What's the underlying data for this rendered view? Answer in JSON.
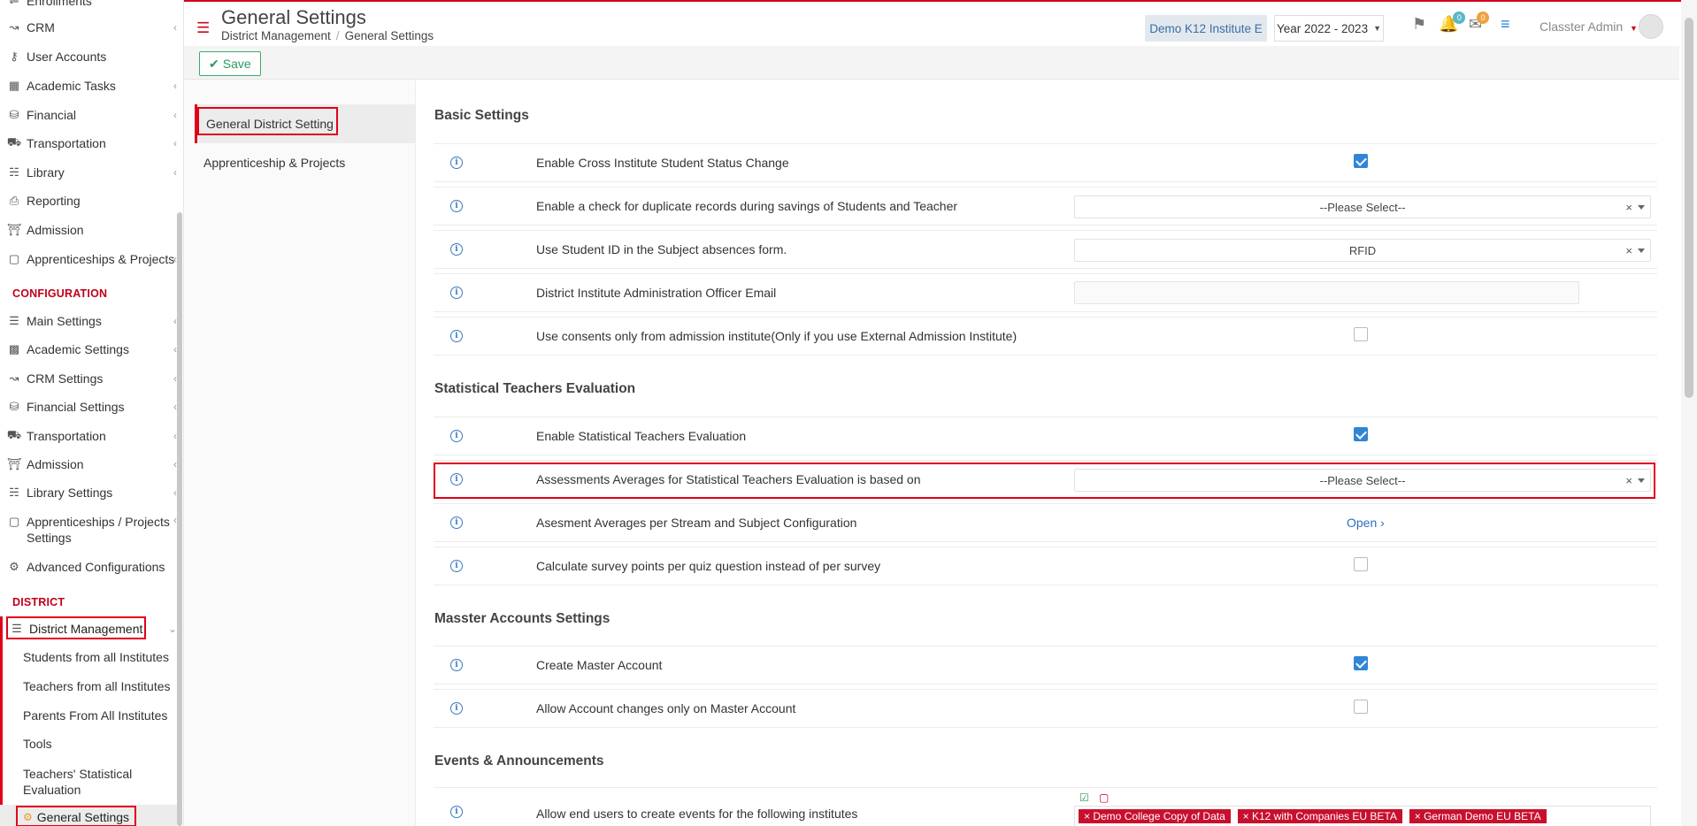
{
  "sidebar": {
    "items_top": [
      {
        "label": "Enrollments",
        "icon": "enrollments-icon"
      },
      {
        "label": "CRM",
        "icon": "crm-icon"
      },
      {
        "label": "User Accounts",
        "icon": "key-icon"
      },
      {
        "label": "Academic Tasks",
        "icon": "grid-icon"
      },
      {
        "label": "Financial",
        "icon": "coins-icon"
      },
      {
        "label": "Transportation",
        "icon": "bus-icon"
      },
      {
        "label": "Library",
        "icon": "books-icon"
      },
      {
        "label": "Reporting",
        "icon": "printer-icon"
      },
      {
        "label": "Admission",
        "icon": "institution-icon"
      },
      {
        "label": "Apprenticeships & Projects",
        "icon": "box-icon"
      }
    ],
    "configuration_title": "CONFIGURATION",
    "items_config": [
      {
        "label": "Main Settings",
        "icon": "sliders-icon"
      },
      {
        "label": "Academic Settings",
        "icon": "people-icon"
      },
      {
        "label": "CRM Settings",
        "icon": "crm-icon"
      },
      {
        "label": "Financial Settings",
        "icon": "coins-icon"
      },
      {
        "label": "Transportation",
        "icon": "bus-icon"
      },
      {
        "label": "Admission",
        "icon": "institution-icon"
      },
      {
        "label": "Library Settings",
        "icon": "books-icon"
      },
      {
        "label": "Apprenticeships / Projects Settings",
        "icon": "box-icon"
      },
      {
        "label": "Advanced Configurations",
        "icon": "gears-icon"
      }
    ],
    "district_title": "DISTRICT",
    "district_management": "District Management",
    "district_sub": [
      "Students from all Institutes",
      "Teachers from all Institutes",
      "Parents From All Institutes",
      "Tools",
      "Teachers' Statistical Evaluation"
    ],
    "general_settings": "General Settings"
  },
  "header": {
    "title": "General Settings",
    "breadcrumb": [
      "District Management",
      "General Settings"
    ],
    "institute": "Demo K12 Institute E",
    "year": "Year 2022 - 2023",
    "notifications_count": "0",
    "messages_count": "0",
    "user": "Classter Admin"
  },
  "toolbar": {
    "save_label": "Save"
  },
  "tabs": [
    "General District Setting",
    "Apprenticeship & Projects"
  ],
  "sections": {
    "basic": "Basic Settings",
    "statistical": "Statistical Teachers Evaluation",
    "master": "Masster Accounts Settings",
    "events": "Events & Announcements"
  },
  "rows": {
    "r1": "Enable Cross Institute Student Status Change",
    "r2": "Enable a check for duplicate records during savings of Students and Teacher",
    "r2_value": "--Please Select--",
    "r3": "Use Student ID in the Subject absences form.",
    "r3_value": "RFID",
    "r4": "District Institute Administration Officer Email",
    "r5": "Use consents only from admission institute(Only if you use External Admission Institute)",
    "r6": "Enable Statistical Teachers Evaluation",
    "r7": "Assessments Averages for Statistical Teachers Evaluation is based on",
    "r7_value": "--Please Select--",
    "r8": "Asesment Averages per Stream and Subject Configuration",
    "r8_link": "Open",
    "r9": "Calculate survey points per quiz question instead of per survey",
    "r10": "Create Master Account",
    "r11": "Allow Account changes only on Master Account",
    "r12": "Allow end users to create events for the following institutes",
    "r12_tags": [
      "Demo College Copy of Data",
      "K12 with Companies EU BETA",
      "German Demo EU BETA"
    ]
  },
  "checkbox_states": {
    "r1": true,
    "r5": false,
    "r6": true,
    "r9": false,
    "r10": true,
    "r11": false
  },
  "colors": {
    "accent": "#d0021b",
    "link": "#2a6ebb",
    "checkbox": "#2f86d6",
    "save": "#2c9a5a"
  }
}
